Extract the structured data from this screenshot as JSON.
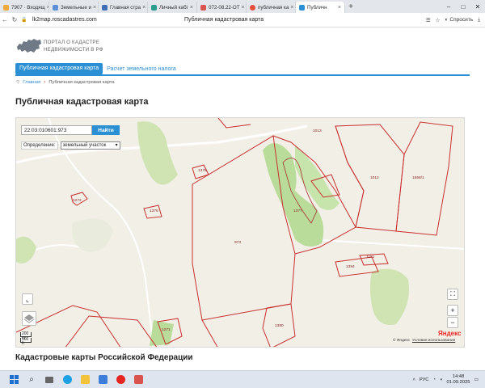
{
  "browser": {
    "tabs": [
      {
        "label": "7907 · Входящ",
        "color": "#f0a93b",
        "active": false
      },
      {
        "label": "Земельные и",
        "color": "#5b8fd8",
        "active": false
      },
      {
        "label": "Главная стра",
        "color": "#3f6fb5",
        "active": false
      },
      {
        "label": "Личный кабі",
        "color": "#2a9d8f",
        "active": false
      },
      {
        "label": "072-08.22-ОТ",
        "color": "#d9534f",
        "active": false
      },
      {
        "label": "публичная ка",
        "color": "#e74c3c",
        "active": false
      },
      {
        "label": "Публичн",
        "color": "#2b8fd3",
        "active": true
      }
    ],
    "url": "lk2map.roscadastres.com",
    "page_title": "Публичная кадастровая карта",
    "ask_label": "Спросить"
  },
  "site": {
    "logo_line1": "ПОРТАЛ О КАДАСТРЕ",
    "logo_line2": "НЕДВИЖИМОСТИ В РФ",
    "nav_active": "Публичная кадастровая карта",
    "nav_link": "Расчет земельного налога",
    "breadcrumb_home": "Главная",
    "breadcrumb_current": "Публичная кадастровая карта",
    "heading": "Публичная кадастровая карта",
    "section_heading": "Кадастровые карты Российской Федерации"
  },
  "map": {
    "search_value": "22:03:010601:973",
    "search_button": "Найти",
    "definition_label": "Определение:",
    "definition_value": "земельный участок",
    "zoom_in": "+",
    "zoom_out": "−",
    "fullscreen": "⛶",
    "scale_top": "200 m",
    "scale_bottom": "500 ft",
    "provider": "Яндекс",
    "copyright": "© Яндекс",
    "terms": "Условия использования",
    "parcels": [
      "1013",
      "1012",
      "1658/1",
      "1378",
      "1272",
      "1376",
      "1377",
      "973",
      "1181",
      "1384",
      "1380",
      "1271"
    ]
  },
  "taskbar": {
    "lang": "РУС",
    "time": "14:48",
    "date": "01.09.2025"
  }
}
